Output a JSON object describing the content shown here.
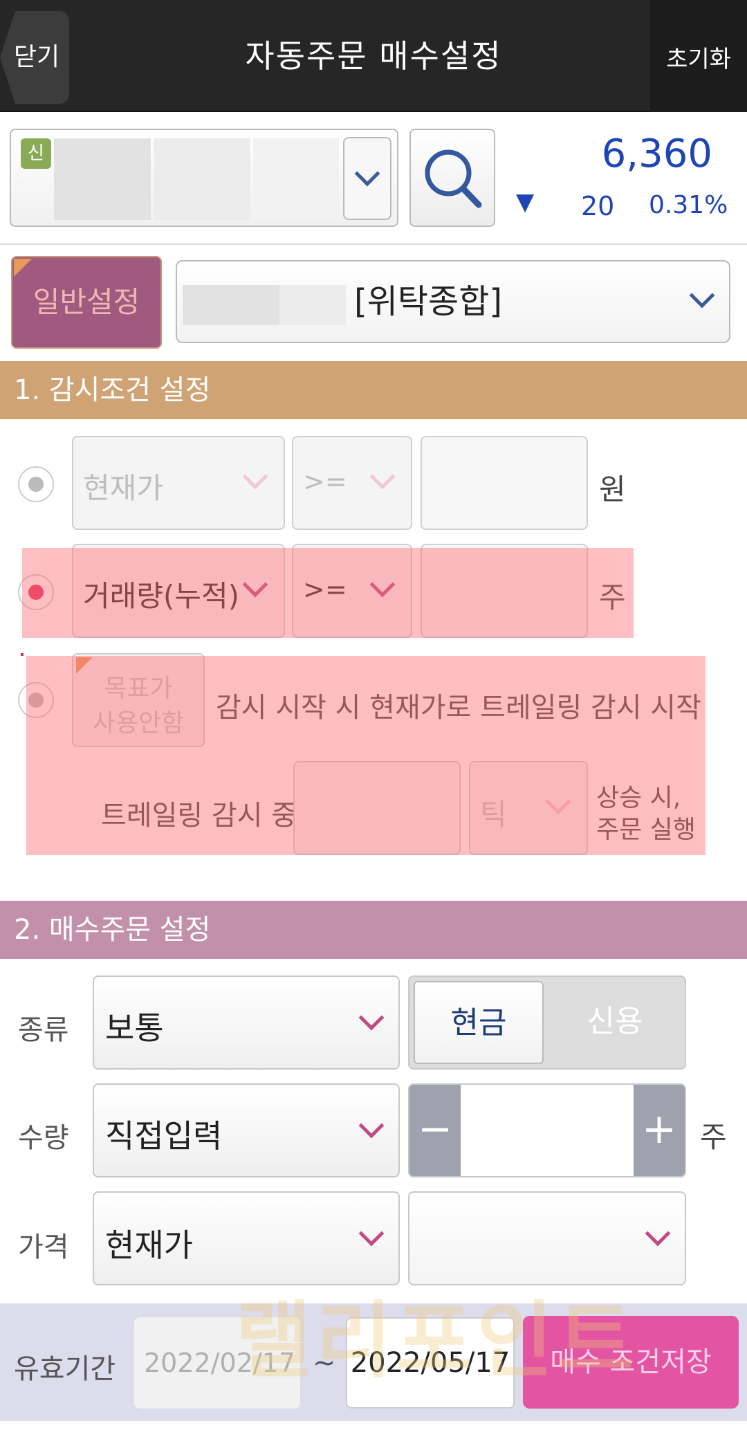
{
  "header": {
    "close_label": "닫기",
    "title": "자동주문 매수설정",
    "reset_label": "초기화"
  },
  "stock": {
    "badge": "신",
    "price": "6,360",
    "change_arrow": "▼",
    "change_value": "20",
    "change_percent": "0.31%"
  },
  "mode": {
    "button_label": "일반설정",
    "account_label": "[위탁종합]"
  },
  "section1": {
    "title": "1. 감시조건 설정",
    "row1": {
      "field": "현재가",
      "operator": ">=",
      "value": "",
      "unit": "원",
      "selected": false
    },
    "row2": {
      "field": "거래량(누적)",
      "operator": ">=",
      "value": "",
      "unit": "주",
      "selected": true
    },
    "row3": {
      "target_line1": "목표가",
      "target_line2": "사용안함",
      "description": "감시 시작 시 현재가로 트레일링 감시 시작",
      "trailing_label": "트레일링 감시 중",
      "tick_value": "",
      "tick_unit": "틱",
      "suffix_line1": "상승 시,",
      "suffix_line2": "주문 실행",
      "selected": false
    }
  },
  "section2": {
    "title": "2. 매수주문 설정",
    "type_label": "종류",
    "type_value": "보통",
    "cash_label": "현금",
    "credit_label": "신용",
    "qty_label": "수량",
    "qty_mode": "직접입력",
    "qty_value": "",
    "qty_minus": "−",
    "qty_plus": "+",
    "qty_unit": "주",
    "price_label": "가격",
    "price_mode": "현재가",
    "price_value": ""
  },
  "footer": {
    "period_label": "유효기간",
    "date_from": "2022/02/17",
    "tilde": "~",
    "date_to": "2022/05/17",
    "save_label": "매수 조건저장"
  },
  "watermark": "랠리포인트",
  "colors": {
    "header_bg": "#262626",
    "accent_blue": "#1e45b5",
    "section1_bg": "#cfa373",
    "section2_bg": "#c290aa",
    "save_button": "#e354a2",
    "chevron": "#c04a82"
  }
}
